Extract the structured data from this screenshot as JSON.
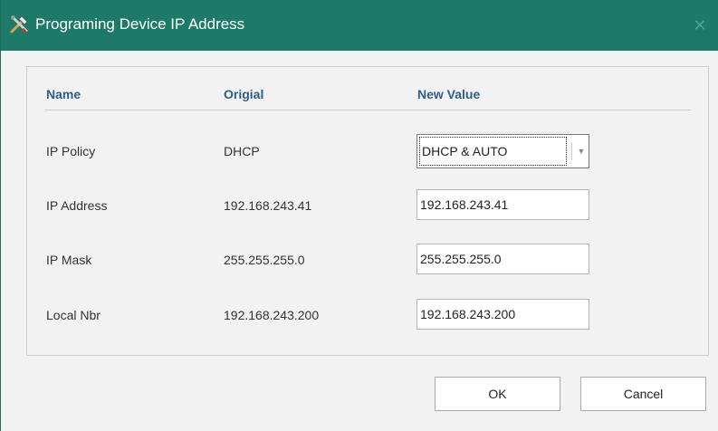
{
  "window": {
    "title": "Programing Device IP Address",
    "title_bar_color": "#1e7a68",
    "icon": "tools-icon",
    "close_label": "✕"
  },
  "table": {
    "headers": {
      "name": "Name",
      "original": "Origial",
      "new_value": "New Value"
    },
    "rows": [
      {
        "name": "IP Policy",
        "original": "DHCP",
        "new_value": "DHCP & AUTO",
        "control": "select"
      },
      {
        "name": "IP Address",
        "original": "192.168.243.41",
        "new_value": "192.168.243.41",
        "control": "input"
      },
      {
        "name": "IP Mask",
        "original": "255.255.255.0",
        "new_value": "255.255.255.0",
        "control": "input"
      },
      {
        "name": "Local Nbr",
        "original": "192.168.243.200",
        "new_value": "192.168.243.200",
        "control": "input"
      }
    ]
  },
  "buttons": {
    "ok": "OK",
    "cancel": "Cancel"
  },
  "colors": {
    "header_text": "#2c5f8a"
  }
}
